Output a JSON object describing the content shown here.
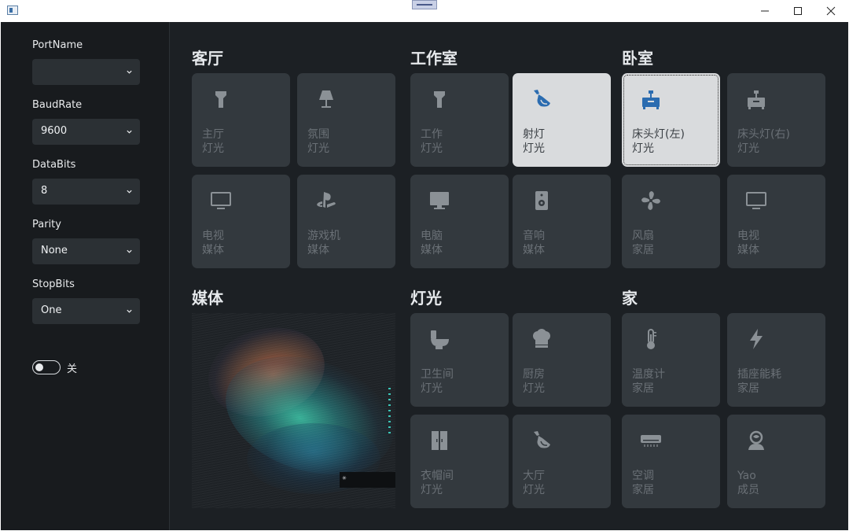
{
  "sidebar": {
    "fields": [
      {
        "label": "PortName",
        "value": ""
      },
      {
        "label": "BaudRate",
        "value": "9600"
      },
      {
        "label": "DataBits",
        "value": "8"
      },
      {
        "label": "Parity",
        "value": "None"
      },
      {
        "label": "StopBits",
        "value": "One"
      }
    ],
    "toggle": {
      "label": "关",
      "on": false
    }
  },
  "sections": {
    "living_room": "客厅",
    "studio": "工作室",
    "bedroom": "卧室",
    "media": "媒体",
    "lights": "灯光",
    "home": "家"
  },
  "tiles": {
    "living_room": [
      {
        "name": "主厅",
        "category": "灯光",
        "icon": "flashlight-icon"
      },
      {
        "name": "氛围",
        "category": "灯光",
        "icon": "table-lamp-icon"
      },
      {
        "name": "电视",
        "category": "媒体",
        "icon": "monitor-icon"
      },
      {
        "name": "游戏机",
        "category": "媒体",
        "icon": "playstation-icon"
      }
    ],
    "studio": [
      {
        "name": "工作",
        "category": "灯光",
        "icon": "flashlight-icon"
      },
      {
        "name": "射灯",
        "category": "灯光",
        "icon": "spotlight-icon",
        "active": true
      },
      {
        "name": "电脑",
        "category": "媒体",
        "icon": "desktop-icon"
      },
      {
        "name": "音响",
        "category": "媒体",
        "icon": "speaker-icon"
      }
    ],
    "bedroom": [
      {
        "name": "床头灯(左)",
        "category": "灯光",
        "icon": "bedside-lamp-icon",
        "active": true
      },
      {
        "name": "床头灯(右)",
        "category": "灯光",
        "icon": "bedside-lamp-icon"
      },
      {
        "name": "风扇",
        "category": "家居",
        "icon": "fan-icon"
      },
      {
        "name": "电视",
        "category": "媒体",
        "icon": "monitor-icon"
      }
    ],
    "lights": [
      {
        "name": "卫生间",
        "category": "灯光",
        "icon": "toilet-icon"
      },
      {
        "name": "厨房",
        "category": "灯光",
        "icon": "chef-hat-icon"
      },
      {
        "name": "衣帽间",
        "category": "灯光",
        "icon": "wardrobe-icon"
      },
      {
        "name": "大厅",
        "category": "灯光",
        "icon": "spotlight-icon"
      }
    ],
    "home": [
      {
        "name": "温度计",
        "category": "家居",
        "icon": "thermometer-icon"
      },
      {
        "name": "插座能耗",
        "category": "家居",
        "icon": "lightning-icon"
      },
      {
        "name": "空调",
        "category": "家居",
        "icon": "air-conditioner-icon"
      },
      {
        "name": "Yao",
        "category": "成员",
        "icon": "user-icon"
      }
    ]
  },
  "colors": {
    "active_icon": "#2b6cb0",
    "inactive_icon": "#8b9196",
    "tile_bg": "#33393e",
    "tile_active_bg": "#d9dbdd",
    "window_bg": "#1c2024"
  }
}
